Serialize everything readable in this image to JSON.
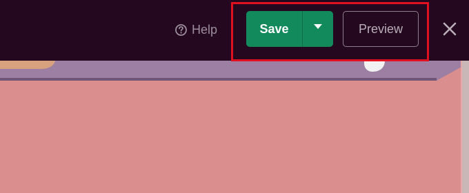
{
  "toolbar": {
    "help_label": "Help",
    "help_icon": "help-circle-icon",
    "save_label": "Save",
    "save_dropdown_icon": "caret-down-icon",
    "preview_label": "Preview",
    "close_icon": "close-icon"
  },
  "colors": {
    "topbar_bg": "#24081f",
    "save_bg": "#138a5c",
    "canvas_bg": "#da8e8d",
    "highlight": "#e0101e"
  }
}
